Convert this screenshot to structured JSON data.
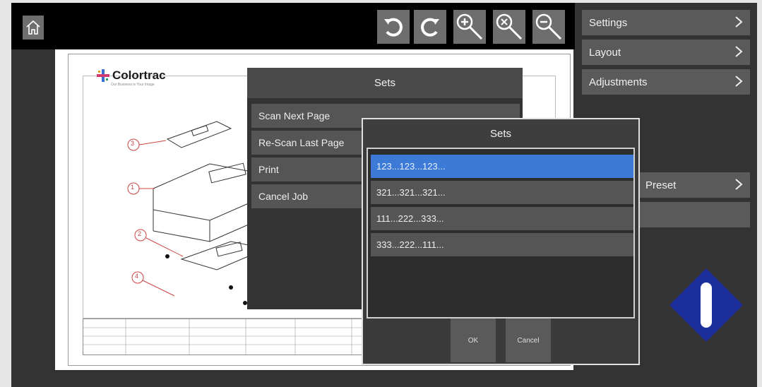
{
  "toolbar": {
    "home_icon": "home-icon",
    "buttons": [
      {
        "name": "rotate-left-icon"
      },
      {
        "name": "rotate-right-icon"
      },
      {
        "name": "zoom-in-icon"
      },
      {
        "name": "zoom-fit-icon"
      },
      {
        "name": "zoom-out-icon"
      }
    ]
  },
  "preview": {
    "logo": "Colortrac",
    "logo_tagline": "Our Business is Your Image",
    "callouts": [
      "3",
      "1",
      "2",
      "4"
    ]
  },
  "side_menu": {
    "items": [
      {
        "label": "Settings"
      },
      {
        "label": "Layout"
      },
      {
        "label": "Adjustments"
      }
    ],
    "preset_label": "Preset"
  },
  "sets_dialog": {
    "title": "Sets",
    "options": [
      "Scan Next Page",
      "Re-Scan Last Page",
      "Print",
      "Cancel Job"
    ]
  },
  "sets_list_dialog": {
    "title": "Sets",
    "items": [
      "123...123...123...",
      "321...321...321...",
      "111...222...333...",
      "333...222...111..."
    ],
    "selected_index": 0,
    "ok_label": "OK",
    "cancel_label": "Cancel"
  },
  "colors": {
    "accent_selected": "#3c7ad6",
    "stop_button": "#1a2f9a"
  }
}
